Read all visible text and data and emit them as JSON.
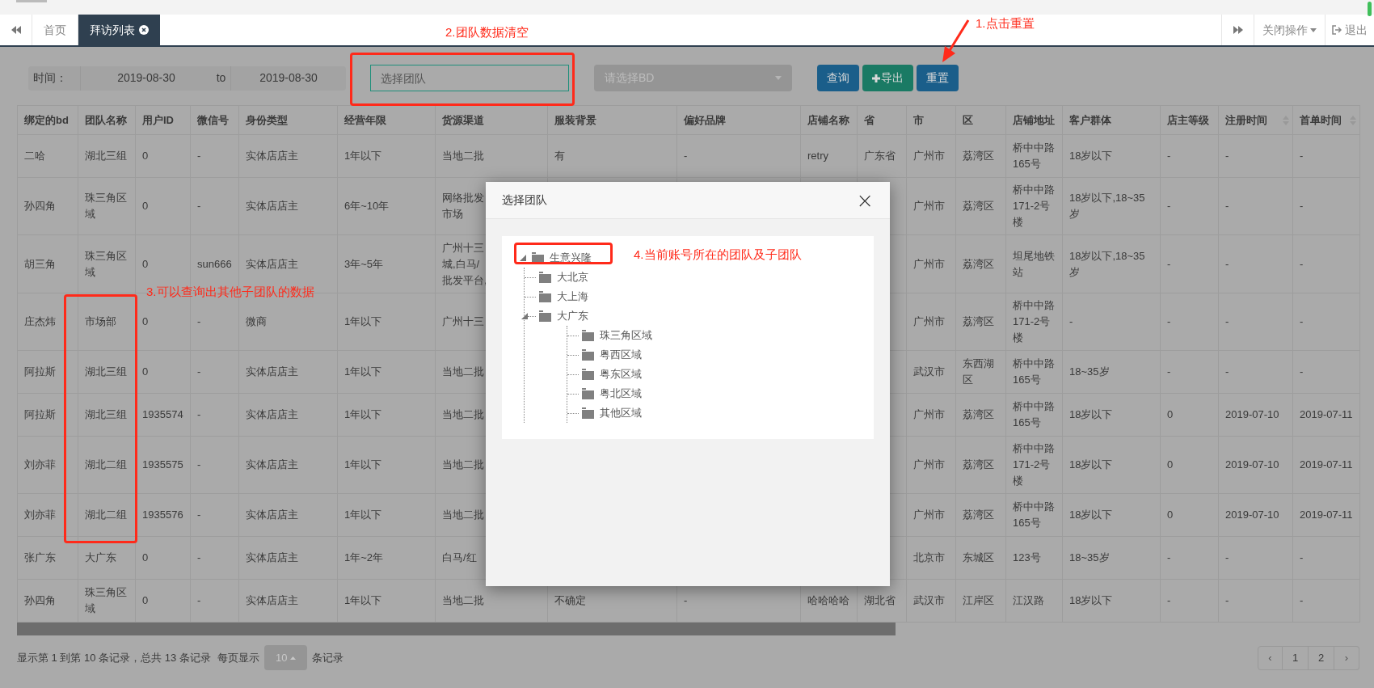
{
  "tab_bar": {
    "tabs": [
      {
        "label": "首页",
        "selected": false,
        "closable": false
      },
      {
        "label": "拜访列表",
        "selected": true,
        "closable": true
      }
    ],
    "close_menu": "关闭操作",
    "logout": "退出"
  },
  "filters": {
    "time_label": "时间：",
    "start_date": "2019-08-30",
    "to": "to",
    "end_date": "2019-08-30",
    "team_placeholder": "选择团队",
    "bd_placeholder": "请选择BD",
    "buttons": [
      {
        "label": "查询",
        "kind": "primary"
      },
      {
        "label": "导出",
        "kind": "export"
      },
      {
        "label": "重置",
        "kind": "primary"
      }
    ]
  },
  "table": {
    "columns": [
      {
        "label": "绑定的bd",
        "sortable": false
      },
      {
        "label": "团队名称",
        "sortable": false
      },
      {
        "label": "用户ID",
        "sortable": false
      },
      {
        "label": "微信号",
        "sortable": false
      },
      {
        "label": "身份类型",
        "sortable": false
      },
      {
        "label": "经营年限",
        "sortable": false
      },
      {
        "label": "货源渠道",
        "sortable": false
      },
      {
        "label": "服装背景",
        "sortable": false
      },
      {
        "label": "偏好品牌",
        "sortable": false
      },
      {
        "label": "店铺名称",
        "sortable": false
      },
      {
        "label": "省",
        "sortable": false
      },
      {
        "label": "市",
        "sortable": false
      },
      {
        "label": "区",
        "sortable": false
      },
      {
        "label": "店铺地址",
        "sortable": false
      },
      {
        "label": "客户群体",
        "sortable": false
      },
      {
        "label": "店主等级",
        "sortable": false
      },
      {
        "label": "注册时间",
        "sortable": true
      },
      {
        "label": "首单时间",
        "sortable": true
      }
    ],
    "rows": [
      [
        "二哈",
        "湖北三组",
        "0",
        "-",
        "实体店店主",
        "1年以下",
        "当地二批",
        "有",
        "-",
        "retry",
        "广东省",
        "广州市",
        "荔湾区",
        "桥中中路165号",
        "18岁以下",
        "-",
        "-",
        "-"
      ],
      [
        "孙四角",
        "珠三角区域",
        "0",
        "-",
        "实体店店主",
        "6年~10年",
        [
          "网络批发",
          "市场"
        ],
        null,
        null,
        null,
        null,
        "广州市",
        "荔湾区",
        "桥中中路171-2号楼",
        "18岁以下,18~35岁",
        "-",
        "-",
        "-"
      ],
      [
        "胡三角",
        "珠三角区域",
        "0",
        "sun666",
        "实体店店主",
        "3年~5年",
        [
          "广州十三",
          "城,白马/",
          "批发平台,"
        ],
        null,
        null,
        null,
        null,
        "广州市",
        "荔湾区",
        "坦尾地铁站",
        "18岁以下,18~35岁",
        "-",
        "-",
        "-"
      ],
      [
        "庄杰炜",
        "市场部",
        "0",
        "-",
        "微商",
        "1年以下",
        "广州十三",
        null,
        null,
        null,
        null,
        "广州市",
        "荔湾区",
        "桥中中路171-2号楼",
        "-",
        "-",
        "-",
        "-"
      ],
      [
        "阿拉斯",
        "湖北三组",
        "0",
        "-",
        "实体店店主",
        "1年以下",
        "当地二批",
        null,
        null,
        null,
        null,
        "武汉市",
        "东西湖区",
        "桥中中路165号",
        "18~35岁",
        "-",
        "-",
        "-"
      ],
      [
        "阿拉斯",
        "湖北三组",
        "1935574",
        "-",
        "实体店店主",
        "1年以下",
        "当地二批",
        null,
        null,
        null,
        null,
        "广州市",
        "荔湾区",
        "桥中中路165号",
        "18岁以下",
        "0",
        "2019-07-10",
        "2019-07-11"
      ],
      [
        "刘亦菲",
        "湖北二组",
        "1935575",
        "-",
        "实体店店主",
        "1年以下",
        "当地二批",
        null,
        null,
        null,
        null,
        "广州市",
        "荔湾区",
        "桥中中路171-2号楼",
        "18岁以下",
        "0",
        "2019-07-10",
        "2019-07-11"
      ],
      [
        "刘亦菲",
        "湖北二组",
        "1935576",
        "-",
        "实体店店主",
        "1年以下",
        "当地二批",
        null,
        null,
        null,
        null,
        "广州市",
        "荔湾区",
        "桥中中路165号",
        "18岁以下",
        "0",
        "2019-07-10",
        "2019-07-11"
      ],
      [
        "张广东",
        "大广东",
        "0",
        "-",
        "实体店店主",
        "1年~2年",
        "白马/红",
        null,
        null,
        null,
        null,
        "北京市",
        "东城区",
        "123号",
        "18~35岁",
        "-",
        "-",
        "-"
      ],
      [
        "孙四角",
        "珠三角区域",
        "0",
        "-",
        "实体店店主",
        "1年以下",
        "当地二批",
        "不确定",
        "-",
        "哈哈哈哈",
        "湖北省",
        "武汉市",
        "江岸区",
        "江汉路",
        "18岁以下",
        "-",
        "-",
        "-"
      ]
    ]
  },
  "footer": {
    "summary": "显示第 1 到第 10 条记录，总共 13 条记录",
    "per_page_label": "每页显示",
    "page_size": "10",
    "per_page_suffix": "条记录",
    "prev": "‹",
    "pages": [
      "1",
      "2"
    ],
    "next": "›"
  },
  "modal": {
    "title": "选择团队",
    "close": "×",
    "tree": [
      {
        "label": "生意兴隆",
        "expanded": true,
        "children": [
          {
            "label": "大北京"
          },
          {
            "label": "大上海"
          },
          {
            "label": "大广东",
            "expanded": true,
            "children": [
              {
                "label": "珠三角区域"
              },
              {
                "label": "粤西区域"
              },
              {
                "label": "粤东区域"
              },
              {
                "label": "粤北区域"
              },
              {
                "label": "其他区域"
              }
            ]
          }
        ]
      }
    ]
  },
  "annotations": [
    {
      "text": "1.点击重置",
      "kind": "arrow"
    },
    {
      "text": "2.团队数据清空",
      "kind": "box"
    },
    {
      "text": "3.可以查询出其他子团队的数据",
      "kind": "box"
    },
    {
      "text": "4.当前账号所在的团队及子团队",
      "kind": "box"
    }
  ]
}
